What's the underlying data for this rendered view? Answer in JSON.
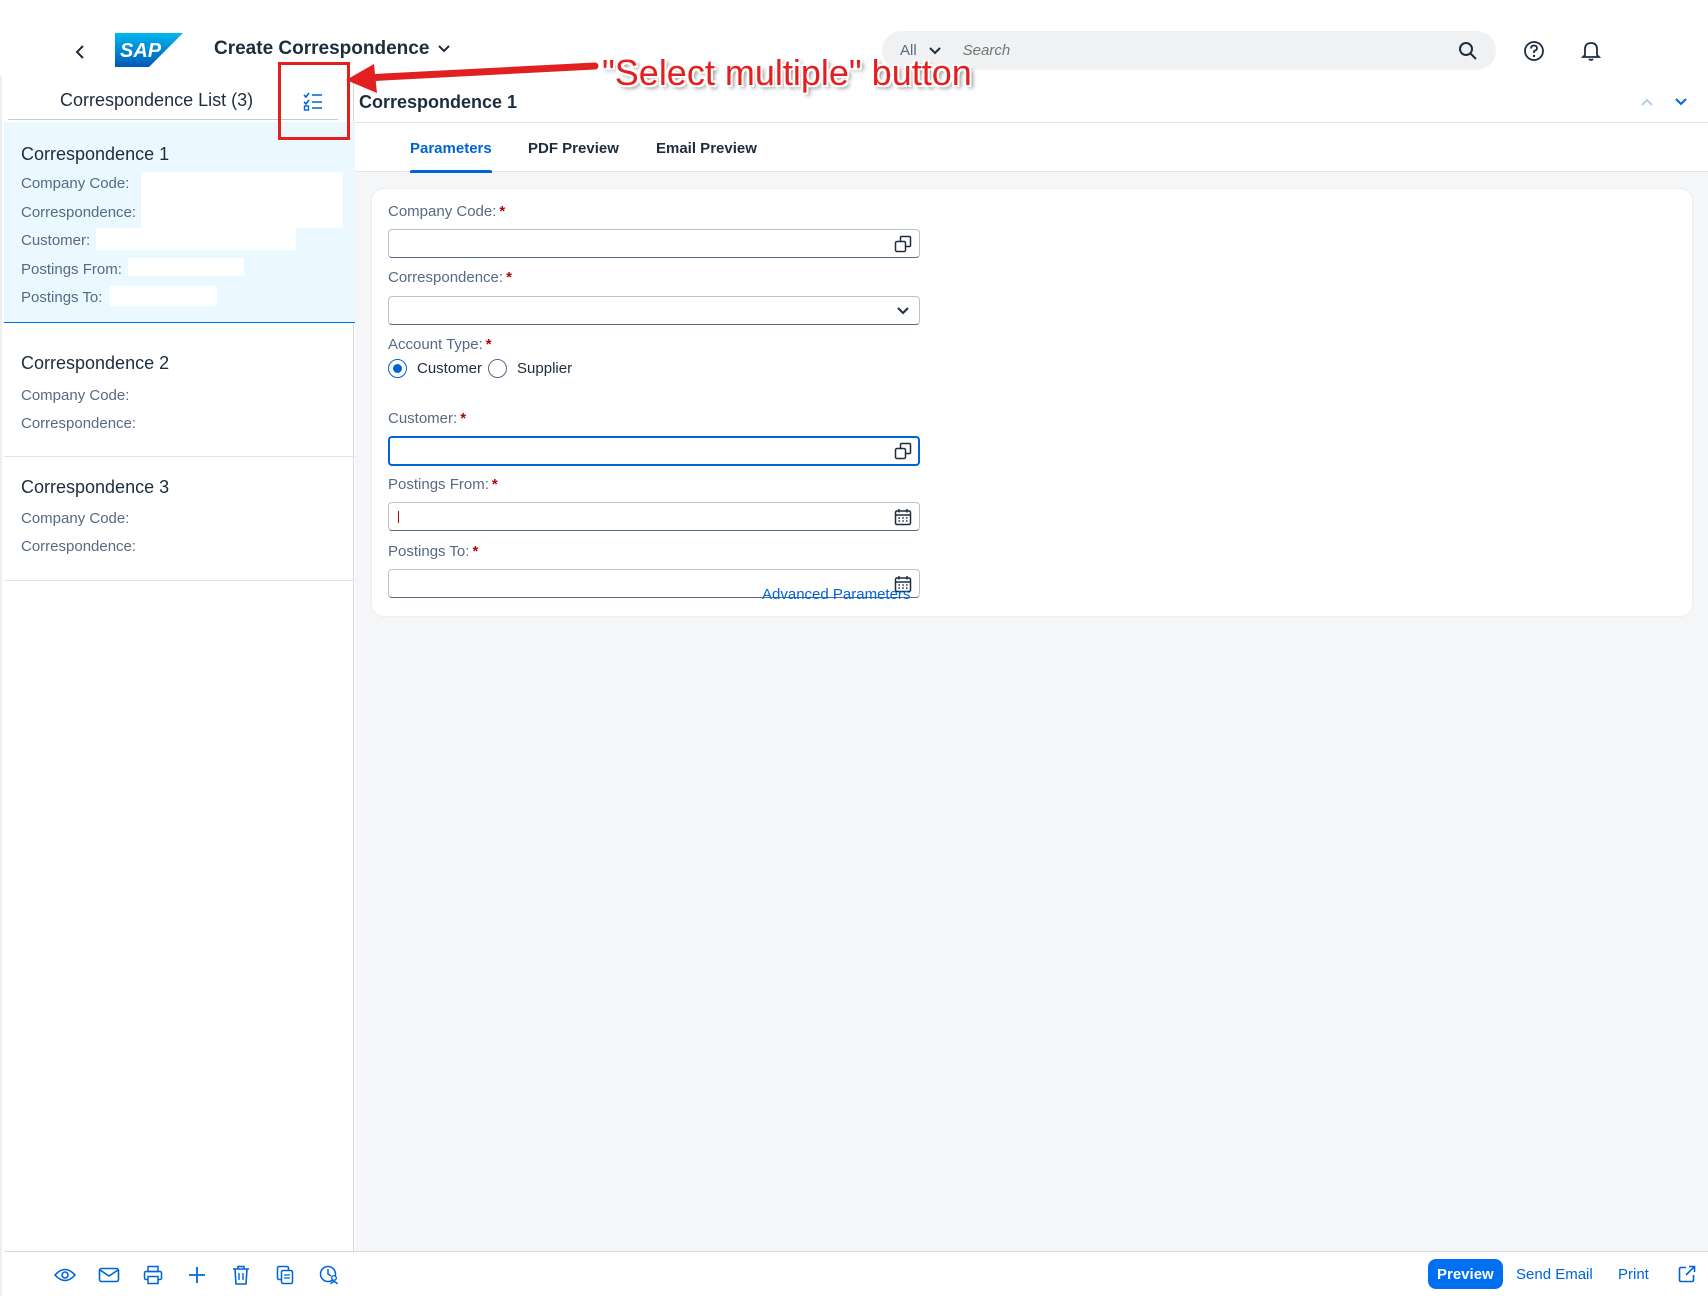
{
  "shell": {
    "title": "Create Correspondence",
    "logo_text": "SAP",
    "search": {
      "scope": "All",
      "placeholder": "Search"
    }
  },
  "master": {
    "title": "Correspondence List (3)",
    "items": [
      {
        "title": "Correspondence 1",
        "lines": [
          "Company Code:",
          "Correspondence:",
          "Customer:",
          "Postings From:",
          "Postings To:"
        ],
        "selected": true
      },
      {
        "title": "Correspondence 2",
        "lines": [
          "Company Code:",
          "Correspondence:"
        ],
        "selected": false
      },
      {
        "title": "Correspondence 3",
        "lines": [
          "Company Code:",
          "Correspondence:"
        ],
        "selected": false
      }
    ],
    "footer_icons": [
      "show-icon",
      "email-icon",
      "print-icon",
      "add-icon",
      "delete-icon",
      "copy-icon",
      "user-settings-icon"
    ]
  },
  "detail": {
    "title": "Correspondence 1",
    "tabs": [
      {
        "label": "Parameters",
        "active": true
      },
      {
        "label": "PDF Preview",
        "active": false
      },
      {
        "label": "Email Preview",
        "active": false
      }
    ],
    "form": {
      "required_marker": "*",
      "company_code": {
        "label": "Company Code:",
        "value": ""
      },
      "correspondence": {
        "label": "Correspondence:",
        "value": ""
      },
      "account_type": {
        "label": "Account Type:",
        "options": [
          "Customer",
          "Supplier"
        ],
        "selected": "Customer"
      },
      "customer": {
        "label": "Customer:",
        "value": ""
      },
      "postings_from": {
        "label": "Postings From:",
        "value": ""
      },
      "postings_to": {
        "label": "Postings To:",
        "value": ""
      },
      "advanced_link": "Advanced Parameters"
    },
    "footer": {
      "preview": "Preview",
      "send_email": "Send Email",
      "print": "Print"
    }
  },
  "annotation": {
    "text": "\"Select multiple\" button",
    "color": "#e32020"
  },
  "colors": {
    "brand": "#0070f2",
    "link": "#0064d9",
    "required": "#aa0808",
    "selected_item_bg": "#ebf8ff"
  }
}
